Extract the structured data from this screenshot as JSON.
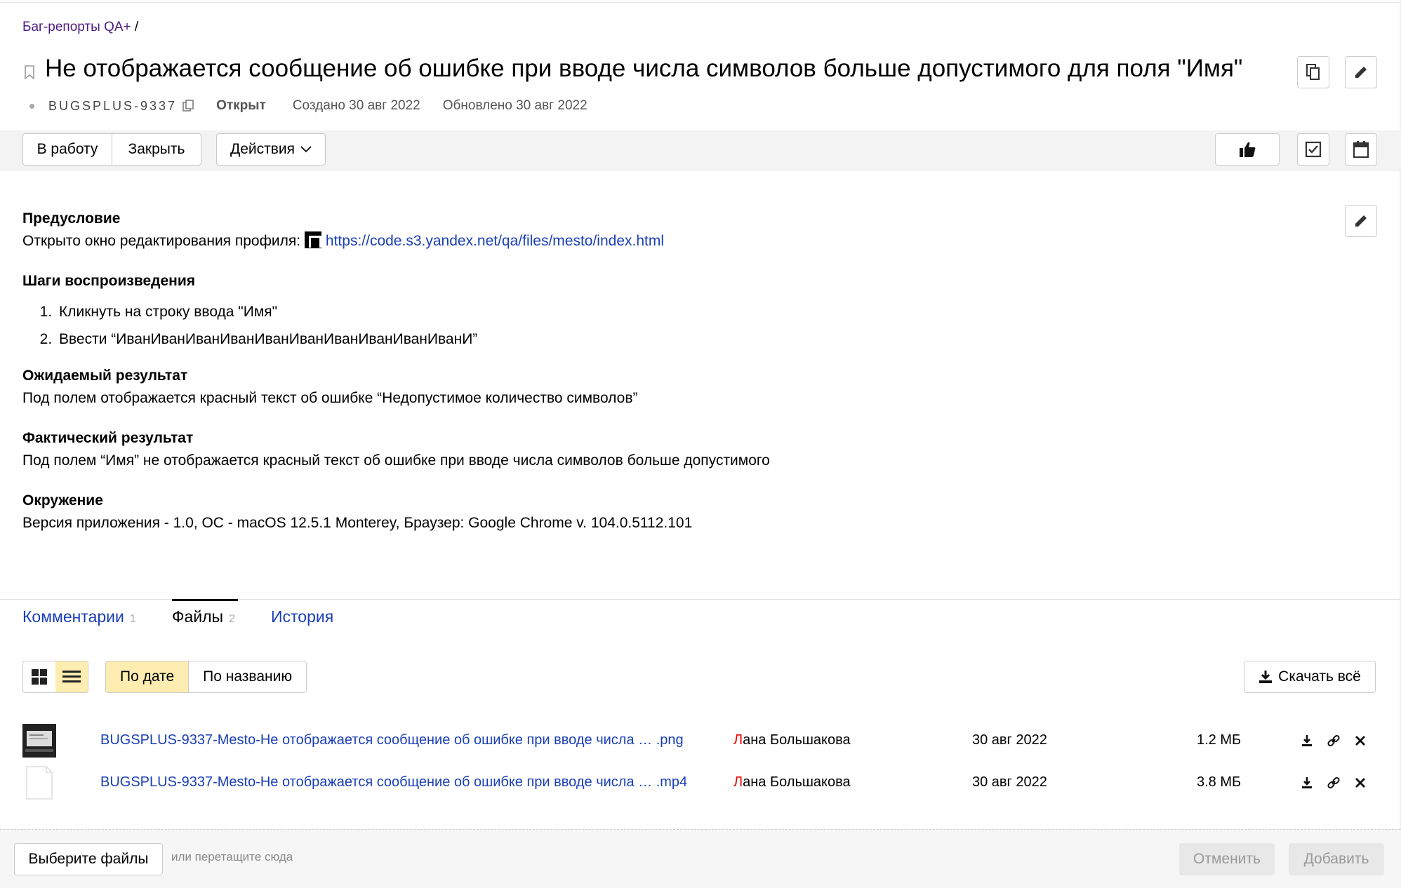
{
  "breadcrumb": {
    "queue_link": "Баг-репорты QA+",
    "separator": "/"
  },
  "issue": {
    "title": "Не отображается сообщение об ошибке при вводе числа символов больше допустимого для поля \"Имя\"",
    "key": "BUGSPLUS-9337",
    "status": "Открыт",
    "created": "Создано 30 авг 2022",
    "updated": "Обновлено 30 авг 2022"
  },
  "toolbar": {
    "to_work": "В работу",
    "close": "Закрыть",
    "actions": "Действия"
  },
  "description": {
    "precondition_heading": "Предусловие",
    "precondition_text": "Открыто окно редактирования профиля:",
    "precondition_link": "https://code.s3.yandex.net/qa/files/mesto/index.html",
    "steps_heading": "Шаги воспроизведения",
    "steps": [
      "Кликнуть на строку ввода \"Имя\"",
      "Ввести “ИванИванИванИванИванИванИванИванИванИванИ”"
    ],
    "expected_heading": "Ожидаемый результат",
    "expected_text": "Под полем отображается красный текст об ошибке “Недопустимое количество символов”",
    "actual_heading": "Фактический результат",
    "actual_text": "Под полем “Имя” не отображается красный текст об ошибке при вводе числа символов больше допустимого",
    "env_heading": "Окружение",
    "env_text": "Версия приложения - 1.0, ОС - macOS 12.5.1 Monterey, Браузер: Google Chrome v. 104.0.5112.101"
  },
  "tabs": [
    {
      "label": "Комментарии",
      "count": "1"
    },
    {
      "label": "Файлы",
      "count": "2"
    },
    {
      "label": "История",
      "count": ""
    }
  ],
  "files_toolbar": {
    "sort_by_date": "По дате",
    "sort_by_name": "По названию",
    "download_all": "Скачать всё"
  },
  "files": [
    {
      "name": "BUGSPLUS-9337-Mesto-Не отображается сообщение об ошибке при вводе числа … .png",
      "author_first": "Л",
      "author_rest": "ана Большакова",
      "date": "30 авг 2022",
      "size": "1.2 МБ"
    },
    {
      "name": "BUGSPLUS-9337-Mesto-Не отображается сообщение об ошибке при вводе числа … .mp4",
      "author_first": "Л",
      "author_rest": "ана Большакова",
      "date": "30 авг 2022",
      "size": "3.8 МБ"
    }
  ],
  "upload": {
    "choose": "Выберите файлы",
    "hint": "или перетащите сюда",
    "cancel": "Отменить",
    "add": "Добавить"
  },
  "icons": [
    "bookmark-icon",
    "copy-icon",
    "clone-icon",
    "pencil-icon",
    "thumb-up-icon",
    "checklist-icon",
    "calendar-icon",
    "chevron-down-icon",
    "grid-icon",
    "list-icon",
    "download-icon",
    "link-icon",
    "close-icon"
  ]
}
